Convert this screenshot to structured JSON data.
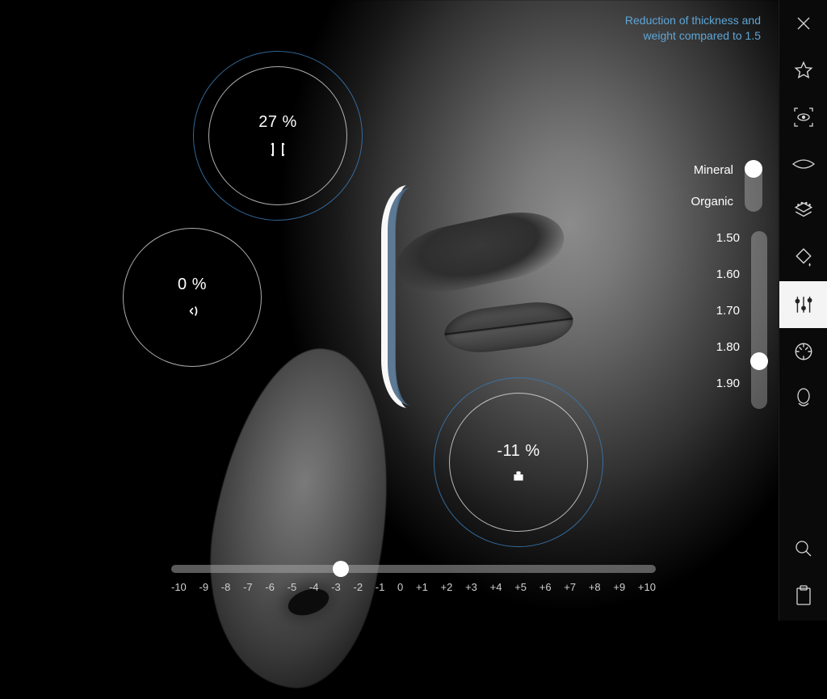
{
  "caption": {
    "line1": "Reduction of thickness and",
    "line2": "weight compared to 1.5"
  },
  "gauges": {
    "thickness": {
      "value": "27 %"
    },
    "distortion": {
      "value": "0 %"
    },
    "weight": {
      "value": "-11 %"
    }
  },
  "material": {
    "option_a": "Mineral",
    "option_b": "Organic",
    "selected": "Mineral"
  },
  "index_slider": {
    "options": [
      "1.50",
      "1.60",
      "1.70",
      "1.80",
      "1.90"
    ],
    "selected": "1.80"
  },
  "diopter_slider": {
    "min": -10,
    "max": 10,
    "value": -3,
    "scale": [
      "-10",
      "-9",
      "-8",
      "-7",
      "-6",
      "-5",
      "-4",
      "-3",
      "-2",
      "-1",
      "0",
      "+1",
      "+2",
      "+3",
      "+4",
      "+5",
      "+6",
      "+7",
      "+8",
      "+9",
      "+10"
    ]
  },
  "toolbar": {
    "items": [
      {
        "name": "close-icon"
      },
      {
        "name": "star-icon"
      },
      {
        "name": "eye-focus-icon"
      },
      {
        "name": "lens-icon"
      },
      {
        "name": "layers-icon"
      },
      {
        "name": "drop-icon"
      },
      {
        "name": "sliders-icon",
        "active": true
      },
      {
        "name": "target-icon"
      },
      {
        "name": "head-icon"
      }
    ],
    "bottom": [
      {
        "name": "search-icon"
      },
      {
        "name": "clipboard-icon"
      }
    ]
  }
}
